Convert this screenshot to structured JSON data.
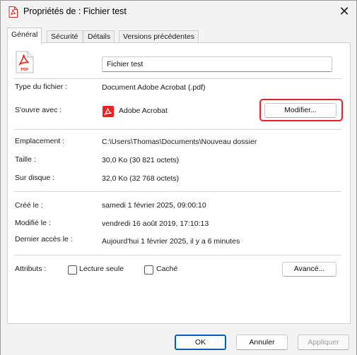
{
  "window": {
    "title": "Propriétés de : Fichier test",
    "close_label": "✕"
  },
  "tabs": [
    {
      "label": "Général",
      "active": true
    },
    {
      "label": "Sécurité",
      "active": false
    },
    {
      "label": "Détails",
      "active": false
    },
    {
      "label": "Versions précédentes",
      "active": false
    }
  ],
  "general": {
    "file_icon_label": "PDF",
    "name_value": "Fichier test",
    "type_label": "Type du fichier :",
    "type_value": "Document Adobe Acrobat (.pdf)",
    "opens_with_label": "S'ouvre avec :",
    "opens_with_value": "Adobe Acrobat",
    "change_button": "Modifier...",
    "location_label": "Emplacement :",
    "location_value": "C:\\Users\\Thomas\\Documents\\Nouveau dossier",
    "size_label": "Taille :",
    "size_value": "30,0 Ko (30 821 octets)",
    "size_on_disk_label": "Sur disque :",
    "size_on_disk_value": "32,0 Ko (32 768 octets)",
    "created_label": "Créé le :",
    "created_value": "samedi 1 février 2025, 09:00:10",
    "modified_label": "Modifié le :",
    "modified_value": "vendredi 16 août 2019, 17:10:13",
    "accessed_label": "Dernier accès le :",
    "accessed_value": "Aujourd'hui 1 février 2025, il y a 6 minutes",
    "attributes_label": "Attributs :",
    "readonly_label": "Lecture seule",
    "readonly_checked": false,
    "hidden_label": "Caché",
    "hidden_checked": false,
    "advanced_button": "Avancé..."
  },
  "footer": {
    "ok": "OK",
    "cancel": "Annuler",
    "apply": "Appliquer"
  },
  "colors": {
    "pdf_red": "#e22820",
    "highlight": "#e5252a",
    "accent": "#005fb8"
  }
}
